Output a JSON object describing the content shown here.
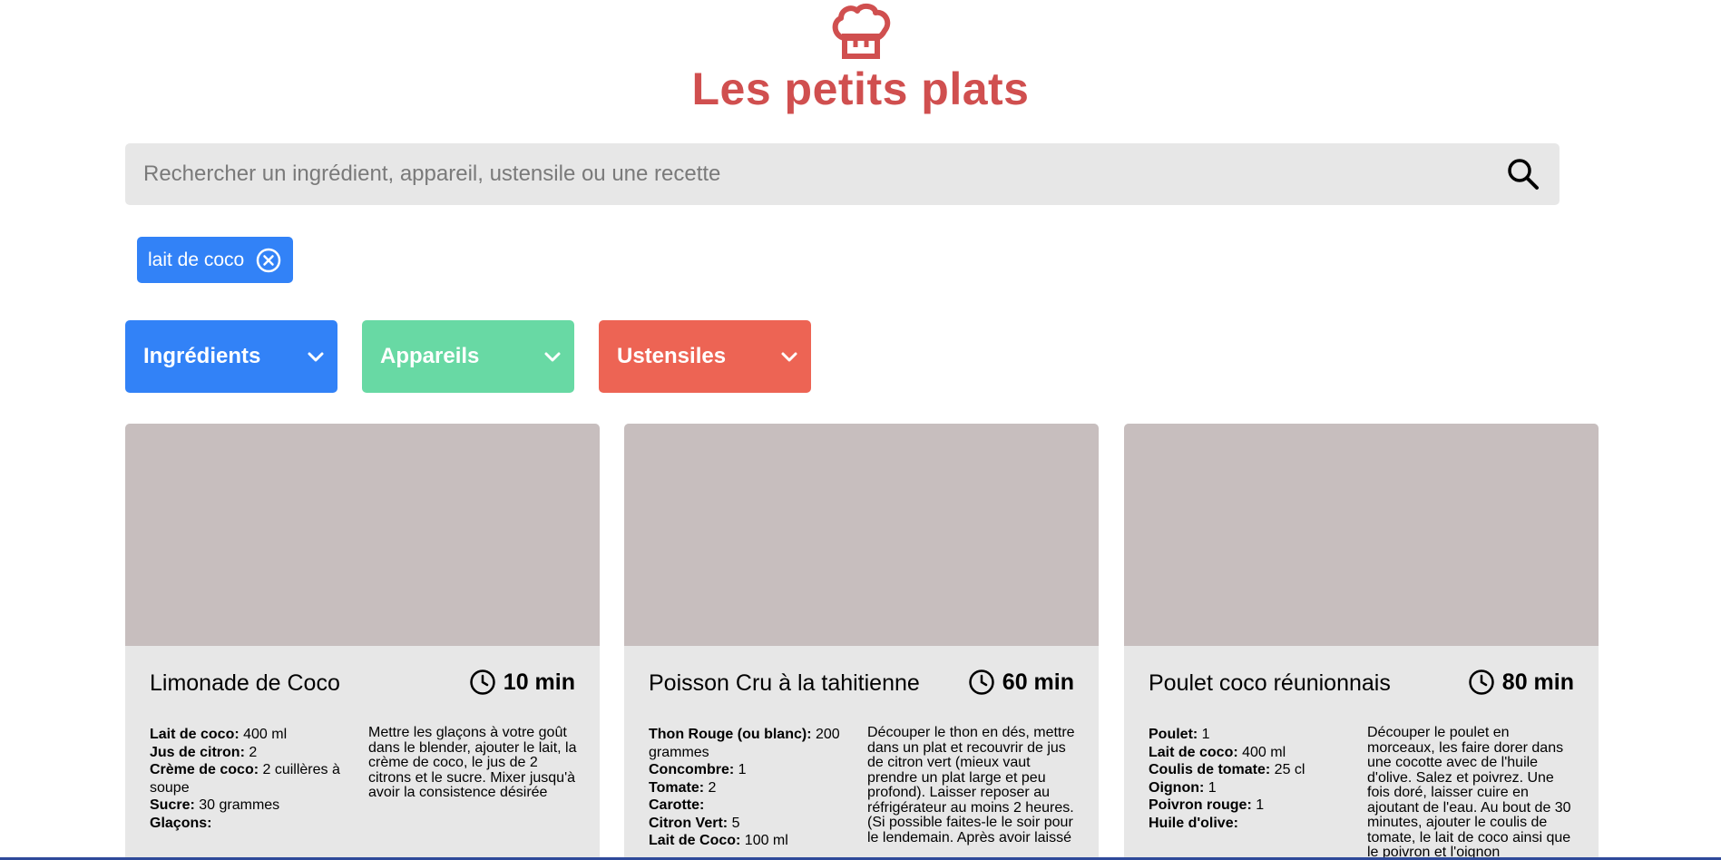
{
  "header": {
    "logo_icon": "chef-hat-icon",
    "title": "Les petits plats",
    "title_color": "#d04f4f"
  },
  "search": {
    "placeholder": "Rechercher un ingrédient, appareil, ustensile ou une recette",
    "value": "",
    "icon": "search-icon"
  },
  "selected_tags": [
    {
      "label": "lait de coco",
      "color": "#3282f7"
    }
  ],
  "filters": [
    {
      "label": "Ingrédients",
      "color": "#3282f7"
    },
    {
      "label": "Appareils",
      "color": "#68d9a4"
    },
    {
      "label": "Ustensiles",
      "color": "#ed6454"
    }
  ],
  "recipes": [
    {
      "title": "Limonade de Coco",
      "time": "10 min",
      "ingredients": [
        {
          "name": "Lait de coco:",
          "qty": " 400 ml"
        },
        {
          "name": "Jus de citron:",
          "qty": " 2"
        },
        {
          "name": "Crème de coco:",
          "qty": " 2 cuillères à soupe"
        },
        {
          "name": "Sucre:",
          "qty": " 30 grammes"
        },
        {
          "name": "Glaçons:",
          "qty": ""
        }
      ],
      "description": "Mettre les glaçons à votre goût dans le blender, ajouter le lait, la crème de coco, le jus de 2 citrons et le sucre. Mixer jusqu'à avoir la consistence désirée"
    },
    {
      "title": "Poisson Cru à la tahitienne",
      "time": "60 min",
      "ingredients": [
        {
          "name": "Thon Rouge (ou blanc):",
          "qty": " 200 grammes"
        },
        {
          "name": "Concombre:",
          "qty": " 1"
        },
        {
          "name": "Tomate:",
          "qty": " 2"
        },
        {
          "name": "Carotte:",
          "qty": ""
        },
        {
          "name": "Citron Vert:",
          "qty": " 5"
        },
        {
          "name": "Lait de Coco:",
          "qty": " 100 ml"
        }
      ],
      "description": "Découper le thon en dés, mettre dans un plat et recouvrir de jus de citron vert (mieux vaut prendre un plat large et peu profond). Laisser reposer au réfrigérateur au moins 2 heures. (Si possible faites-le le soir pour le lendemain. Après avoir laissé"
    },
    {
      "title": "Poulet coco réunionnais",
      "time": "80 min",
      "ingredients": [
        {
          "name": "Poulet:",
          "qty": " 1"
        },
        {
          "name": "Lait de coco:",
          "qty": " 400 ml"
        },
        {
          "name": "Coulis de tomate:",
          "qty": " 25 cl"
        },
        {
          "name": "Oignon:",
          "qty": " 1"
        },
        {
          "name": "Poivron rouge:",
          "qty": " 1"
        },
        {
          "name": "Huile d'olive:",
          "qty": ""
        }
      ],
      "description": "Découper le poulet en morceaux, les faire dorer dans une cocotte avec de l'huile d'olive. Salez et poivrez. Une fois doré, laisser cuire en ajoutant de l'eau. Au bout de 30 minutes, ajouter le coulis de tomate, le lait de coco ainsi que le poivron et l'oignon"
    }
  ]
}
